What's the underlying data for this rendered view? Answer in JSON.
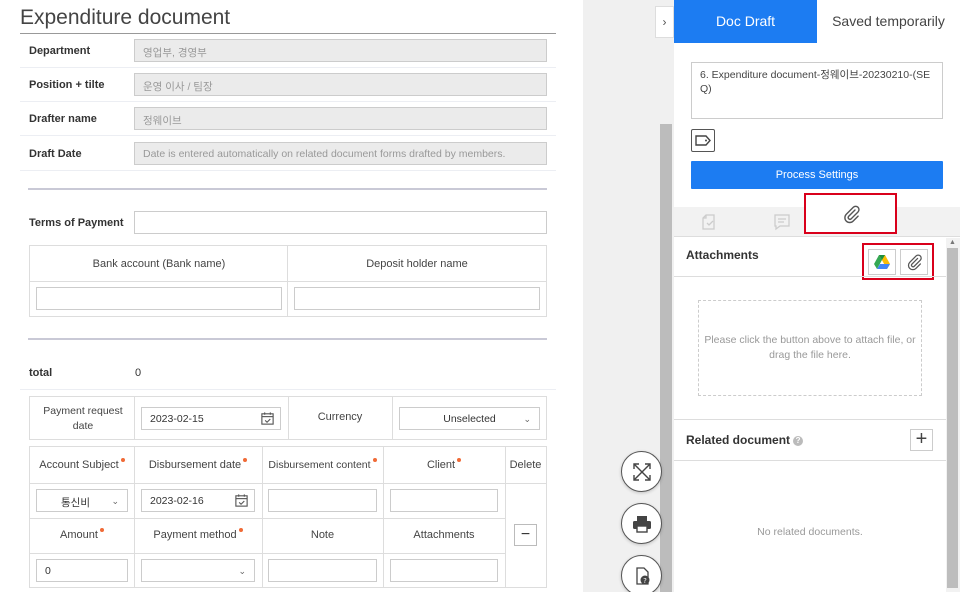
{
  "document": {
    "title": "Expenditure document",
    "fields": [
      {
        "label": "Department",
        "value": "영업부, 경영부"
      },
      {
        "label": "Position + tilte",
        "value": "운영 이사 / 팀장"
      },
      {
        "label": "Drafter name",
        "value": "정웨이브"
      },
      {
        "label": "Draft Date",
        "value": "Date is entered automatically on related document forms drafted by members."
      }
    ],
    "terms_label": "Terms of Payment",
    "terms_value": "",
    "bank_account_header": "Bank account (Bank name)",
    "deposit_holder_header": "Deposit holder name",
    "total_label": "total",
    "total_value": "0",
    "payment_request_date_label": "Payment request date",
    "payment_request_date_value": "2023-02-15",
    "currency_label": "Currency",
    "currency_value": "Unselected",
    "table": {
      "headers": [
        "Account Subject",
        "Disbursement date",
        "Disbursement content",
        "Client",
        "Delete"
      ],
      "required": [
        true,
        true,
        true,
        true,
        false
      ],
      "row": {
        "account_subject": "통신비",
        "disbursement_date": "2023-02-16",
        "disbursement_content": "",
        "client": ""
      },
      "headers2": [
        "Amount",
        "Payment method",
        "Note",
        "Attachments"
      ],
      "required2": [
        true,
        true,
        false,
        false
      ],
      "row2": {
        "amount": "0",
        "payment_method": "",
        "note": "",
        "attachments": ""
      },
      "delete_symbol": "−"
    }
  },
  "gutter": {
    "toggle_symbol": "›",
    "buttons": [
      "expand-icon",
      "print-icon",
      "doc-help-icon"
    ]
  },
  "panel": {
    "tabs": [
      "Doc Draft",
      "Saved temporarily"
    ],
    "doc_title": "6. Expenditure document-정웨이브-20230210-(SEQ)",
    "process_settings": "Process Settings",
    "attachments_title": "Attachments",
    "dropzone_text": "Please click the button above to attach file, or drag the file here.",
    "related_title": "Related document",
    "related_help": "?",
    "add_symbol": "+",
    "no_related": "No related documents."
  },
  "colors": {
    "accent": "#1c7cf2",
    "highlight": "#d9001b",
    "required_dot": "#f06a36"
  }
}
